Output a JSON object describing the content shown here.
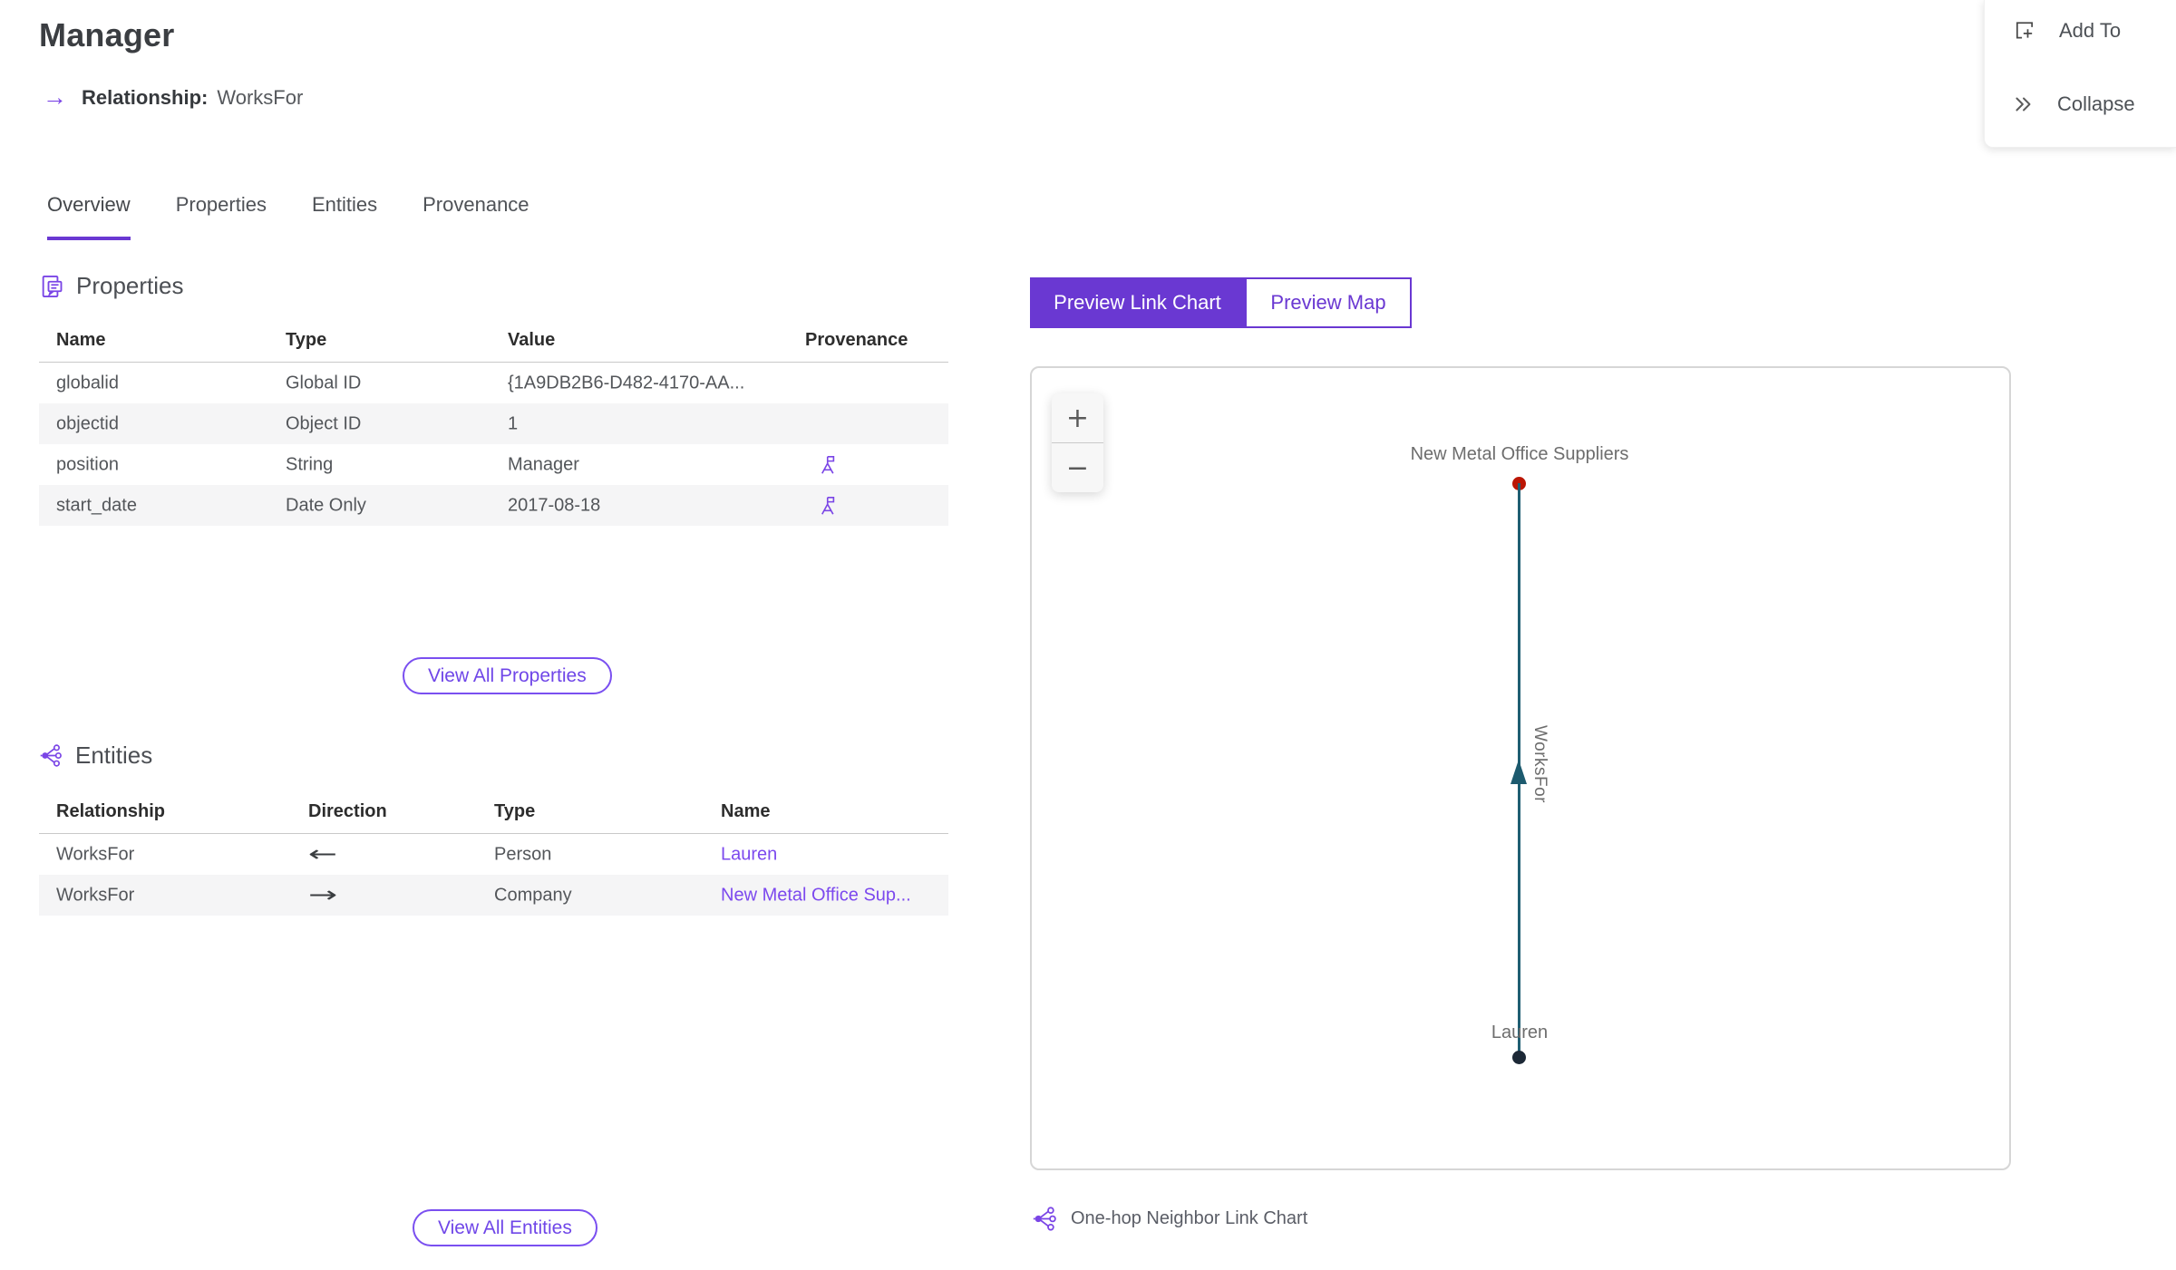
{
  "page": {
    "title": "Manager"
  },
  "relationship": {
    "arrow": "→",
    "label": "Relationship:",
    "value": "WorksFor"
  },
  "panel_actions": {
    "add_to": "Add To",
    "collapse": "Collapse"
  },
  "tabs": {
    "overview": "Overview",
    "properties": "Properties",
    "entities": "Entities",
    "provenance": "Provenance"
  },
  "properties_section": {
    "heading": "Properties",
    "columns": {
      "name": "Name",
      "type": "Type",
      "value": "Value",
      "provenance": "Provenance"
    },
    "rows": [
      {
        "name": "globalid",
        "type": "Global ID",
        "value": "{1A9DB2B6-D482-4170-AA..."
      },
      {
        "name": "objectid",
        "type": "Object ID",
        "value": "1"
      },
      {
        "name": "position",
        "type": "String",
        "value": "Manager"
      },
      {
        "name": "start_date",
        "type": "Date Only",
        "value": "2017-08-18"
      }
    ],
    "view_all": "View All Properties"
  },
  "entities_section": {
    "heading": "Entities",
    "columns": {
      "relationship": "Relationship",
      "direction": "Direction",
      "type": "Type",
      "name": "Name"
    },
    "rows": [
      {
        "relationship": "WorksFor",
        "direction": "←",
        "type": "Person",
        "name": "Lauren"
      },
      {
        "relationship": "WorksFor",
        "direction": "→",
        "type": "Company",
        "name": "New Metal Office Sup..."
      }
    ],
    "view_all": "View All Entities"
  },
  "preview": {
    "link_chart_tab": "Preview Link Chart",
    "map_tab": "Preview Map",
    "zoom_in": "+",
    "zoom_out": "−",
    "caption": "One-hop Neighbor Link Chart"
  },
  "chart_data": {
    "type": "link-chart",
    "nodes": [
      {
        "id": "company",
        "label": "New Metal Office Suppliers",
        "color": "#bb1605",
        "position": "top"
      },
      {
        "id": "person",
        "label": "Lauren",
        "color": "#1c2836",
        "position": "bottom"
      }
    ],
    "edges": [
      {
        "from": "person",
        "to": "company",
        "label": "WorksFor",
        "color": "#1f5e72",
        "arrow_direction": "up"
      }
    ]
  },
  "colors": {
    "accent": "#6a38d2",
    "link": "#7c49ee",
    "node_red": "#bb1605",
    "node_navy": "#1c2836",
    "edge_teal": "#1f5e72"
  }
}
